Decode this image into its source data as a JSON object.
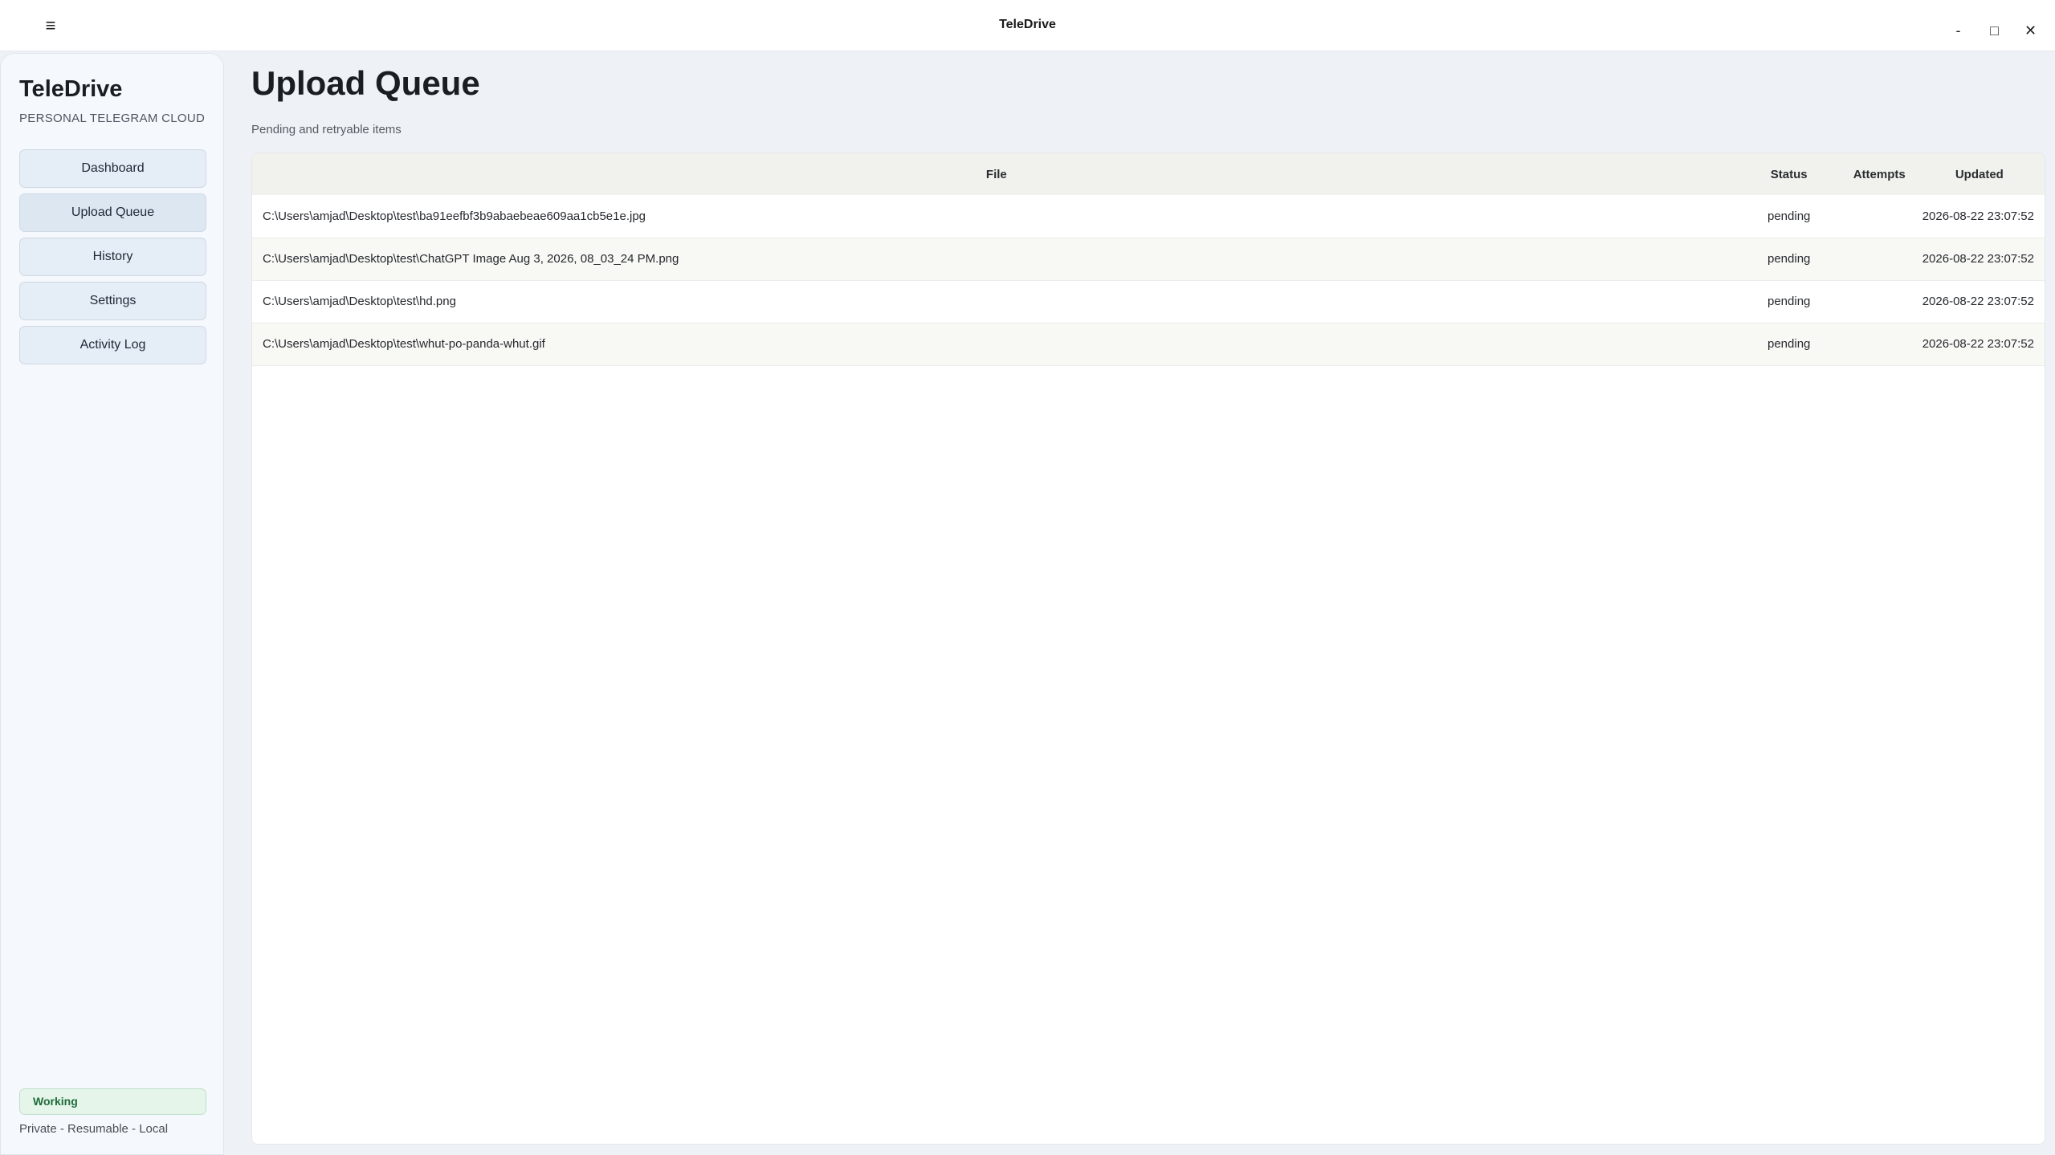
{
  "window": {
    "title": "TeleDrive",
    "menu_icon": "hamburger-icon",
    "controls": {
      "minimize": "-",
      "maximize": "□",
      "close": "✕"
    }
  },
  "sidebar": {
    "brand": "TeleDrive",
    "tagline": "PERSONAL TELEGRAM CLOUD",
    "items": [
      {
        "label": "Dashboard"
      },
      {
        "label": "Upload Queue"
      },
      {
        "label": "History"
      },
      {
        "label": "Settings"
      },
      {
        "label": "Activity Log"
      }
    ],
    "status": "Working",
    "footer": "Private - Resumable - Local"
  },
  "main": {
    "title": "Upload Queue",
    "subtitle": "Pending and retryable items",
    "table": {
      "columns": [
        "File",
        "Status",
        "Attempts",
        "Updated"
      ],
      "rows": [
        {
          "file": "C:\\Users\\amjad\\Desktop\\test\\ba91eefbf3b9abaebeae609aa1cb5e1e.jpg",
          "status": "pending",
          "attempts": "",
          "updated": "2026-08-22 23:07:52"
        },
        {
          "file": "C:\\Users\\amjad\\Desktop\\test\\ChatGPT Image Aug 3, 2026, 08_03_24 PM.png",
          "status": "pending",
          "attempts": "",
          "updated": "2026-08-22 23:07:52"
        },
        {
          "file": "C:\\Users\\amjad\\Desktop\\test\\hd.png",
          "status": "pending",
          "attempts": "",
          "updated": "2026-08-22 23:07:52"
        },
        {
          "file": "C:\\Users\\amjad\\Desktop\\test\\whut-po-panda-whut.gif",
          "status": "pending",
          "attempts": "",
          "updated": "2026-08-22 23:07:52"
        }
      ]
    }
  }
}
